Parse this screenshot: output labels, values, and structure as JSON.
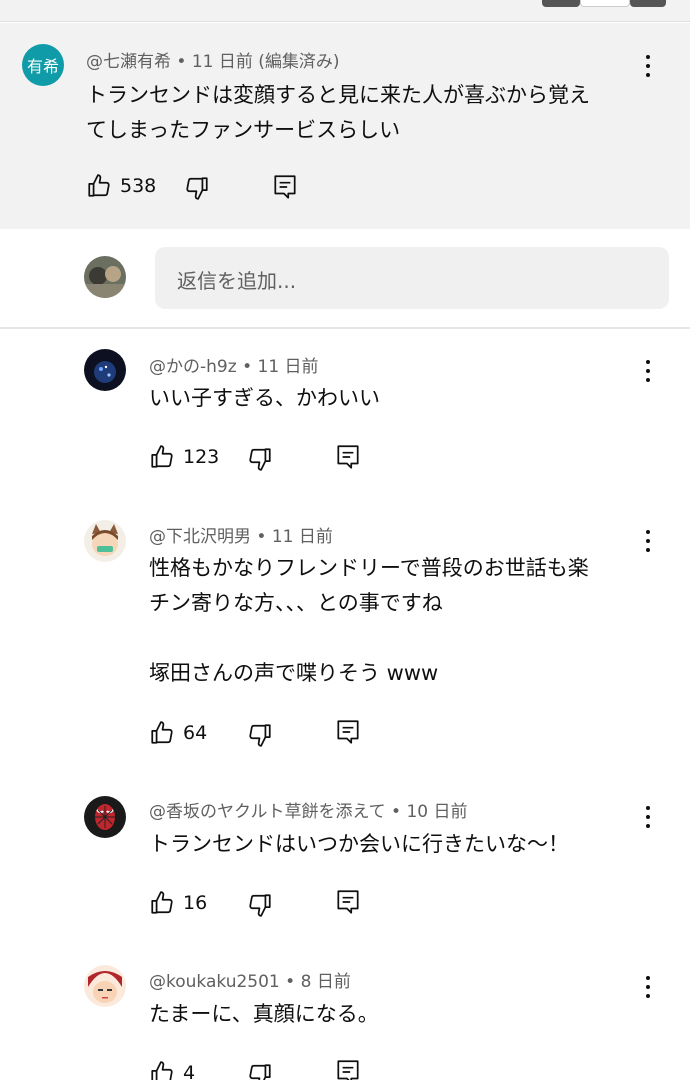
{
  "main_comment": {
    "avatar_text": "有希",
    "author": "@七瀬有希",
    "time": "11 日前 (編集済み)",
    "text": "トランセンドは変顔すると見に来た人が喜ぶから覚え\nてしまったファンサービスらしい",
    "likes": "538"
  },
  "reply_input": {
    "placeholder": "返信を追加..."
  },
  "replies": [
    {
      "author": "@かの-h9z",
      "time": "11 日前",
      "text": "いい子すぎる、かわいい",
      "likes": "123"
    },
    {
      "author": "@下北沢明男",
      "time": "11 日前",
      "text": "性格もかなりフレンドリーで普段のお世話も楽\nチン寄りな方、、、との事ですね\n\n塚田さんの声で喋りそう www",
      "likes": "64"
    },
    {
      "author": "@香坂のヤクルト草餅を添えて",
      "time": "10 日前",
      "text": "トランセンドはいつか会いに行きたいな～！",
      "likes": "16"
    },
    {
      "author": "@koukaku2501",
      "time": "8 日前",
      "text": "たまーに、真顔になる。",
      "likes": "4"
    }
  ],
  "separator": "•",
  "icons": {
    "like": "thumbs-up-icon",
    "dislike": "thumbs-down-icon",
    "reply": "reply-comment-icon",
    "more": "more-vertical-icon"
  },
  "colors": {
    "highlight_bg": "#f2f2f2",
    "avatar_teal": "#0f9ba8",
    "meta_text": "#606060"
  }
}
